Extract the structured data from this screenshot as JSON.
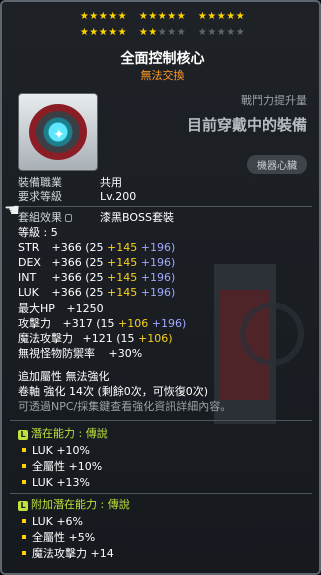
{
  "stars": {
    "row1": [
      "★★★★★",
      "★★★★★",
      "★★★★★"
    ],
    "row2_on": [
      "★★★★★",
      "★★"
    ],
    "row2_off": [
      "★★★"
    ],
    "row2_off2": [
      "★★★★★"
    ]
  },
  "item": {
    "name": "全面控制核心",
    "trade": "無法交換",
    "stat_increase_label": "戰鬥力提升量",
    "equipped_text": "目前穿戴中的裝備",
    "category_badge": "機器心臟"
  },
  "req": {
    "job_label": "裝備職業",
    "job_value": "共用",
    "level_label": "要求等級",
    "level_value": "Lv.200"
  },
  "set": {
    "label": "套組效果",
    "value": "漆黑BOSS套裝"
  },
  "grade": "等級 : 5",
  "stats": [
    {
      "name": "STR",
      "total": "+366",
      "base": "(25",
      "bonus1": "+145",
      "bonus2": "+196)"
    },
    {
      "name": "DEX",
      "total": "+366",
      "base": "(25",
      "bonus1": "+145",
      "bonus2": "+196)"
    },
    {
      "name": "INT",
      "total": "+366",
      "base": "(25",
      "bonus1": "+145",
      "bonus2": "+196)"
    },
    {
      "name": "LUK",
      "total": "+366",
      "base": "(25",
      "bonus1": "+145",
      "bonus2": "+196)"
    }
  ],
  "maxhp": {
    "label": "最大HP",
    "value": "+1250"
  },
  "att": {
    "label": "攻擊力",
    "total": "+317",
    "base": "(15",
    "bonus1": "+106",
    "bonus2": "+196)"
  },
  "matt": {
    "label": "魔法攻擊力",
    "total": "+121",
    "base": "(15",
    "bonus1": "+106)"
  },
  "ignore": {
    "label": "無視怪物防禦率",
    "value": "+30%"
  },
  "enhance": {
    "line1": "追加屬性 無法強化",
    "line2": "卷軸 強化 14次 (剩餘0次，可恢復0次)",
    "line3": "可透過NPC/採集鍵查看強化資訊詳細內容。"
  },
  "potential": {
    "title": "潛在能力 : 傳說",
    "lines": [
      "LUK +10%",
      "全屬性 +10%",
      "LUK +13%"
    ]
  },
  "bonus_potential": {
    "title": "附加潛在能力 : 傳說",
    "lines": [
      "LUK +6%",
      "全屬性 +5%",
      "魔法攻擊力 +14"
    ]
  },
  "colors": {
    "star_on": "#ffd400",
    "trade": "#ff9a1f",
    "bonus_yellow": "#f7d11e",
    "bonus_blue": "#9fa8ff",
    "legendary": "#bfe23c"
  }
}
